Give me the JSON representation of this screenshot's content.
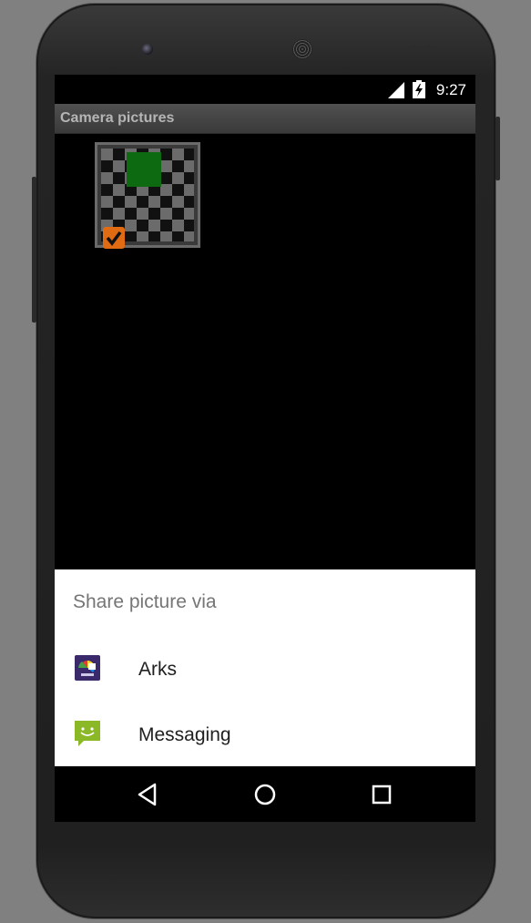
{
  "status_bar": {
    "time": "9:27"
  },
  "app": {
    "title": "Camera pictures"
  },
  "share_sheet": {
    "title": "Share picture via",
    "items": [
      {
        "label": "Arks",
        "icon": "arks-app-icon"
      },
      {
        "label": "Messaging",
        "icon": "messaging-app-icon"
      }
    ]
  },
  "colors": {
    "sheet_background": "#ffffff",
    "title_bar": "#4a4a4a",
    "messaging_green": "#8bb826",
    "arks_purple": "#3b2a6b"
  }
}
